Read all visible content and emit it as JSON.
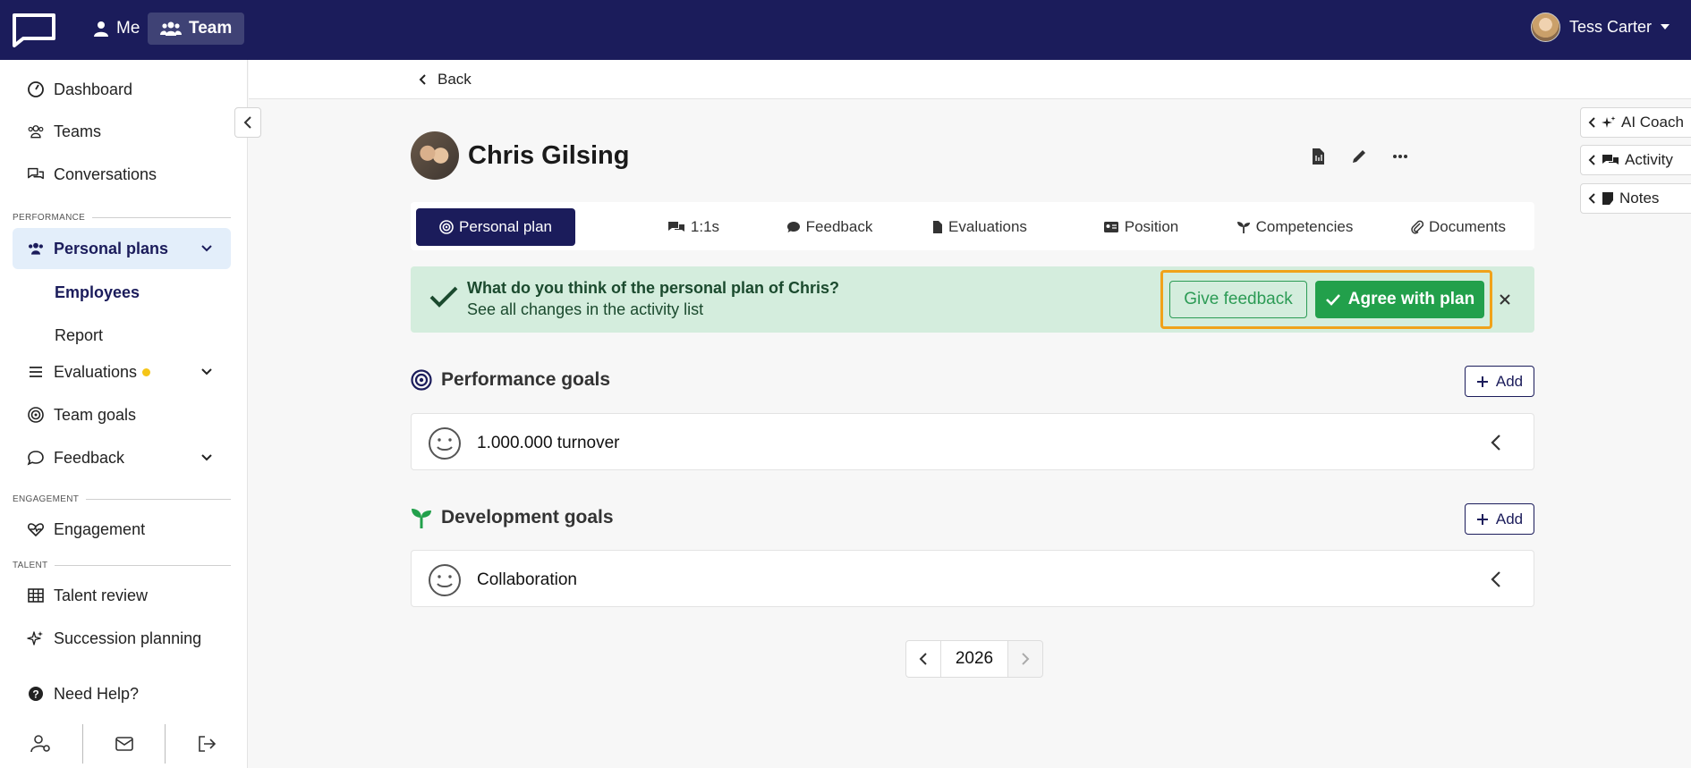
{
  "topbar": {
    "me_label": "Me",
    "team_label": "Team",
    "user_name": "Tess Carter"
  },
  "sidebar": {
    "items": {
      "dashboard": "Dashboard",
      "teams": "Teams",
      "conversations": "Conversations",
      "personal_plans": "Personal plans",
      "employees": "Employees",
      "report": "Report",
      "evaluations": "Evaluations",
      "team_goals": "Team goals",
      "feedback": "Feedback",
      "engagement": "Engagement",
      "talent_review": "Talent review",
      "succession_planning": "Succession planning",
      "need_help": "Need Help?"
    },
    "sections": {
      "performance": "PERFORMANCE",
      "engagement": "ENGAGEMENT",
      "talent": "TALENT"
    }
  },
  "back_label": "Back",
  "profile": {
    "name": "Chris Gilsing"
  },
  "right_panel": {
    "ai_coach": "AI Coach",
    "activity": "Activity",
    "notes": "Notes"
  },
  "tabs": {
    "personal_plan": "Personal plan",
    "one_on_ones": "1:1s",
    "feedback": "Feedback",
    "evaluations": "Evaluations",
    "position": "Position",
    "competencies": "Competencies",
    "documents": "Documents"
  },
  "banner": {
    "title": "What do you think of the personal plan of Chris?",
    "subtitle": "See all changes in the activity list",
    "give_feedback": "Give feedback",
    "agree": "Agree with plan"
  },
  "performance_goals": {
    "title": "Performance goals",
    "add_label": "Add",
    "items": [
      "1.000.000 turnover"
    ]
  },
  "development_goals": {
    "title": "Development goals",
    "add_label": "Add",
    "items": [
      "Collaboration"
    ]
  },
  "pager": {
    "year": "2026"
  },
  "colors": {
    "navy": "#1b1c5b",
    "green": "#22a04b",
    "banner_bg": "#d4eddd",
    "highlight": "#f0a21a"
  }
}
